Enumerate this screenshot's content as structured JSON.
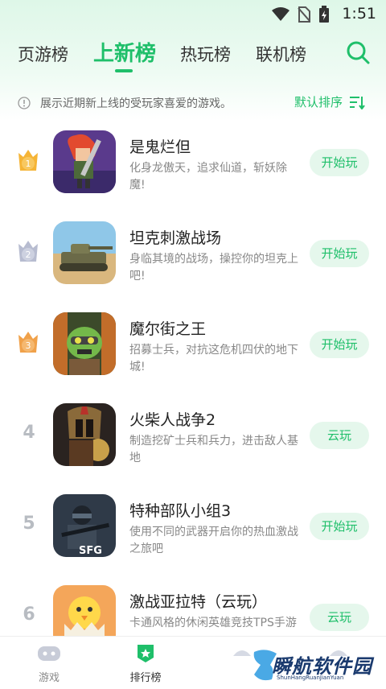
{
  "status_bar": {
    "time": "1:51"
  },
  "tabs": [
    {
      "label": "页游榜",
      "active": false
    },
    {
      "label": "上新榜",
      "active": true
    },
    {
      "label": "热玩榜",
      "active": false
    },
    {
      "label": "联机榜",
      "active": false
    }
  ],
  "notice": {
    "text": "展示近期新上线的受玩家喜爱的游戏。",
    "sort_label": "默认排序"
  },
  "games": [
    {
      "rank": "1",
      "name": "是鬼烂但",
      "desc": "化身龙傲天，追求仙道，斩妖除魔!",
      "action": "开始玩"
    },
    {
      "rank": "2",
      "name": "坦克刺激战场",
      "desc": "身临其境的战场，操控你的坦克上吧!",
      "action": "开始玩"
    },
    {
      "rank": "3",
      "name": "魔尔街之王",
      "desc": "招募士兵，对抗这危机四伏的地下城!",
      "action": "开始玩"
    },
    {
      "rank": "4",
      "name": "火柴人战争2",
      "desc": "制造挖矿士兵和兵力，进击敌人基地",
      "action": "云玩"
    },
    {
      "rank": "5",
      "name": "特种部队小组3",
      "desc": "使用不同的武器开启你的热血激战之旅吧",
      "action": "开始玩"
    },
    {
      "rank": "6",
      "name": "激战亚拉特（云玩）",
      "desc": "卡通风格的休闲英雄竞技TPS手游",
      "action": "云玩"
    }
  ],
  "icon_text": {
    "sfg": "SFG"
  },
  "bottom_nav": [
    {
      "label": "游戏",
      "active": false
    },
    {
      "label": "排行榜",
      "active": true
    }
  ],
  "watermark": {
    "text": "瞬航软件园",
    "sub": "ShunHangRuanJianYuan"
  },
  "colors": {
    "accent": "#1fbf6a",
    "gold": "#f5b436",
    "silver": "#b7bcd0",
    "bronze": "#f0a14a"
  }
}
